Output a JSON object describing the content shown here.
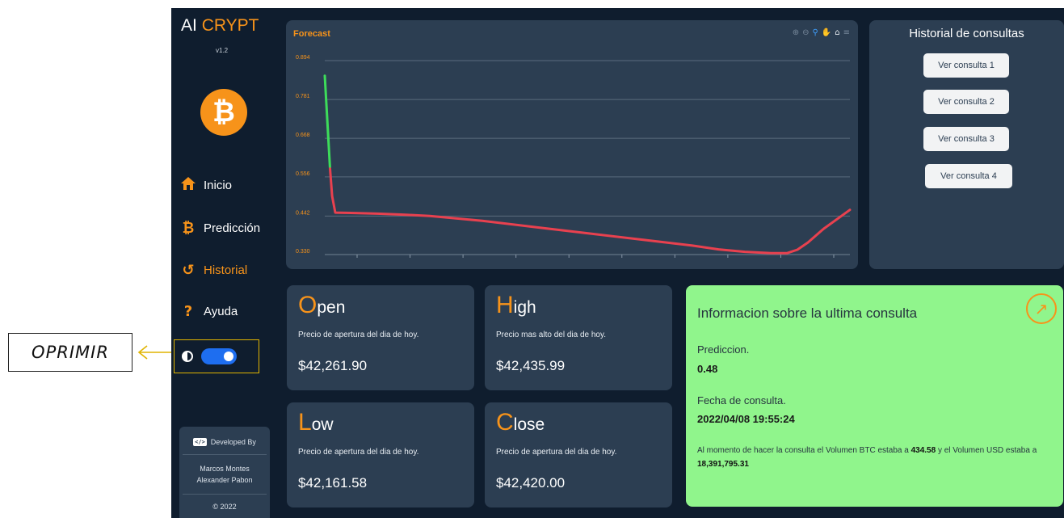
{
  "annotation": {
    "label": "OPRIMIR",
    "color": "#e0b400"
  },
  "brand": {
    "name_plain": "AI ",
    "name_accent": "CRYPT",
    "version": "v1.2",
    "logo_icon": "bitcoin-icon",
    "accent_color": "#f7931a"
  },
  "nav": [
    {
      "label": "Inicio",
      "icon": "home-icon",
      "glyph": "⌂",
      "active": false
    },
    {
      "label": "Predicción",
      "icon": "bitcoin-icon",
      "glyph": "₿",
      "active": false
    },
    {
      "label": "Historial",
      "icon": "history-icon",
      "glyph": "↺",
      "active": true
    },
    {
      "label": "Ayuda",
      "icon": "question-icon",
      "glyph": "?",
      "active": false
    }
  ],
  "theme_toggle": {
    "icon": "contrast-icon",
    "on": true,
    "color": "#1e6ef0"
  },
  "developer": {
    "label": "Developed By",
    "names": [
      "Marcos Montes",
      "Alexander Pabon"
    ],
    "year": "© 2022"
  },
  "chart": {
    "title": "Forecast",
    "toolbar": [
      "zoom-in-icon",
      "zoom-out-icon",
      "magnifier-icon",
      "pan-hand-icon",
      "home-icon",
      "menu-icon"
    ]
  },
  "chart_data": {
    "type": "line",
    "title": "Forecast",
    "xlabel": "",
    "ylabel": "",
    "y_ticks": [
      "0.894",
      "0.781",
      "0.668",
      "0.556",
      "0.442",
      "0.330"
    ],
    "ylim": [
      0.33,
      0.894
    ],
    "x": [
      0,
      0.7,
      1.4,
      2,
      5,
      10,
      15,
      20,
      30,
      40,
      50,
      60,
      70,
      75,
      80,
      85,
      88,
      90,
      92,
      95,
      100
    ],
    "series": [
      {
        "color": "#3ddc5a",
        "x": [
          0,
          1.0
        ],
        "values": [
          0.85,
          0.58
        ]
      },
      {
        "color": "#e8414f",
        "x": [
          1.0,
          1.4,
          2,
          5,
          10,
          15,
          20,
          30,
          40,
          50,
          60,
          70,
          75,
          80,
          85,
          88,
          90,
          92,
          95,
          100
        ],
        "values": [
          0.58,
          0.5,
          0.452,
          0.451,
          0.449,
          0.446,
          0.442,
          0.428,
          0.41,
          0.392,
          0.374,
          0.356,
          0.345,
          0.338,
          0.334,
          0.334,
          0.344,
          0.365,
          0.405,
          0.46
        ]
      }
    ],
    "grid": true,
    "x_tick_count": 9
  },
  "history": {
    "title": "Historial de consultas",
    "buttons": [
      "Ver consulta 1",
      "Ver consulta 2",
      "Ver consulta 3",
      "Ver consulta 4"
    ]
  },
  "cards": {
    "open": {
      "first": "O",
      "rest": "pen",
      "desc": "Precio de apertura del dia de hoy.",
      "value": "$42,261.90"
    },
    "high": {
      "first": "H",
      "rest": "igh",
      "desc": "Precio mas alto del dia de hoy.",
      "value": "$42,435.99"
    },
    "low": {
      "first": "L",
      "rest": "ow",
      "desc": "Precio de apertura del dia de hoy.",
      "value": "$42,161.58"
    },
    "close": {
      "first": "C",
      "rest": "lose",
      "desc": "Precio de apertura del dia de hoy.",
      "value": "$42,420.00"
    }
  },
  "info": {
    "title": "Informacion sobre la ultima consulta",
    "link_icon": "external-link-icon",
    "prediction_label": "Prediccion.",
    "prediction_value": "0.48",
    "date_label": "Fecha de consulta.",
    "date_value": "2022/04/08 19:55:24",
    "note_prefix": "Al momento de hacer la consulta el Volumen BTC estaba a ",
    "btc_volume": "434.58",
    "note_middle": " y el Volumen USD estaba a ",
    "usd_volume": "18,391,795.31",
    "background": "#90f58c"
  }
}
